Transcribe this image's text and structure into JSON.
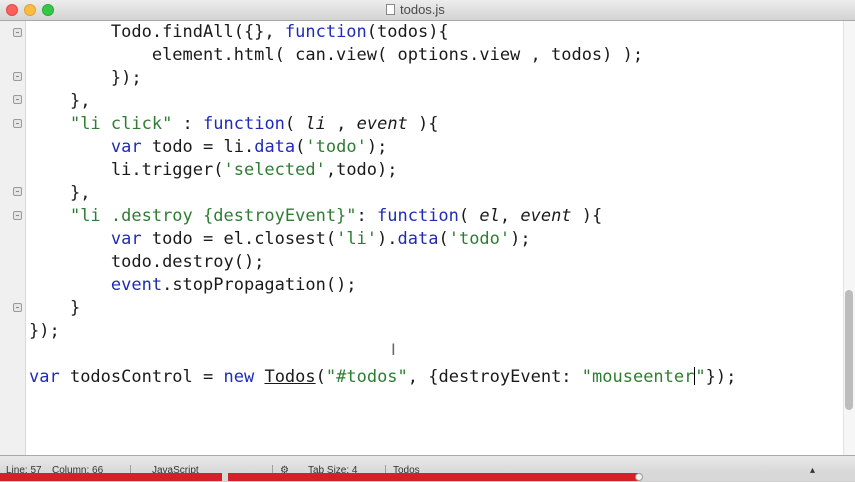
{
  "window": {
    "title": "todos.js"
  },
  "code": {
    "lines": [
      {
        "indent": "        ",
        "tokens": [
          {
            "t": "Todo.findAll({}, ",
            "c": ""
          },
          {
            "t": "function",
            "c": "kw"
          },
          {
            "t": "(todos){",
            "c": ""
          }
        ]
      },
      {
        "indent": "            ",
        "tokens": [
          {
            "t": "element.html( can.view( options.view , todos) );",
            "c": ""
          }
        ]
      },
      {
        "indent": "        ",
        "tokens": [
          {
            "t": "});",
            "c": ""
          }
        ]
      },
      {
        "indent": "    ",
        "tokens": [
          {
            "t": "},",
            "c": ""
          }
        ]
      },
      {
        "indent": "    ",
        "tokens": [
          {
            "t": "\"li click\"",
            "c": "str"
          },
          {
            "t": " : ",
            "c": ""
          },
          {
            "t": "function",
            "c": "kw"
          },
          {
            "t": "( ",
            "c": ""
          },
          {
            "t": "li",
            "c": "it"
          },
          {
            "t": " , ",
            "c": ""
          },
          {
            "t": "event",
            "c": "it"
          },
          {
            "t": " ){",
            "c": ""
          }
        ]
      },
      {
        "indent": "        ",
        "tokens": [
          {
            "t": "var",
            "c": "kw"
          },
          {
            "t": " todo = li.",
            "c": ""
          },
          {
            "t": "data",
            "c": "kw"
          },
          {
            "t": "(",
            "c": ""
          },
          {
            "t": "'todo'",
            "c": "str"
          },
          {
            "t": ");",
            "c": ""
          }
        ]
      },
      {
        "indent": "        ",
        "tokens": [
          {
            "t": "li.trigger(",
            "c": ""
          },
          {
            "t": "'selected'",
            "c": "str"
          },
          {
            "t": ",todo);",
            "c": ""
          }
        ]
      },
      {
        "indent": "    ",
        "tokens": [
          {
            "t": "},",
            "c": ""
          }
        ]
      },
      {
        "indent": "    ",
        "tokens": [
          {
            "t": "\"li .destroy {destroyEvent}\"",
            "c": "str"
          },
          {
            "t": ": ",
            "c": ""
          },
          {
            "t": "function",
            "c": "kw"
          },
          {
            "t": "( ",
            "c": ""
          },
          {
            "t": "el",
            "c": "it"
          },
          {
            "t": ", ",
            "c": ""
          },
          {
            "t": "event",
            "c": "it"
          },
          {
            "t": " ){",
            "c": ""
          }
        ]
      },
      {
        "indent": "        ",
        "tokens": [
          {
            "t": "var",
            "c": "kw"
          },
          {
            "t": " todo = el.closest(",
            "c": ""
          },
          {
            "t": "'li'",
            "c": "str"
          },
          {
            "t": ").",
            "c": ""
          },
          {
            "t": "data",
            "c": "kw"
          },
          {
            "t": "(",
            "c": ""
          },
          {
            "t": "'todo'",
            "c": "str"
          },
          {
            "t": ");",
            "c": ""
          }
        ]
      },
      {
        "indent": "        ",
        "tokens": [
          {
            "t": "todo.destroy();",
            "c": ""
          }
        ]
      },
      {
        "indent": "        ",
        "tokens": [
          {
            "t": "event",
            "c": "kw"
          },
          {
            "t": ".stopPropagation();",
            "c": ""
          }
        ]
      },
      {
        "indent": "    ",
        "tokens": [
          {
            "t": "}",
            "c": ""
          }
        ]
      },
      {
        "indent": "",
        "tokens": [
          {
            "t": "});",
            "c": ""
          }
        ]
      },
      {
        "indent": "",
        "tokens": []
      },
      {
        "indent": "",
        "tokens": [
          {
            "t": "var",
            "c": "kw"
          },
          {
            "t": " todosControl = ",
            "c": ""
          },
          {
            "t": "new",
            "c": "kw"
          },
          {
            "t": " ",
            "c": ""
          },
          {
            "t": "Todos",
            "c": "ul"
          },
          {
            "t": "(",
            "c": ""
          },
          {
            "t": "\"#todos\"",
            "c": "str"
          },
          {
            "t": ", {destroyEvent: ",
            "c": ""
          },
          {
            "t": "\"mouseenter",
            "c": "str"
          },
          {
            "t": "",
            "c": "caret"
          },
          {
            "t": "\"",
            "c": "str"
          },
          {
            "t": "});",
            "c": ""
          }
        ]
      }
    ]
  },
  "status": {
    "line": "Line: 57",
    "column": "Column: 66",
    "syntax": "JavaScript",
    "tab_size": "Tab Size: 4",
    "symbol": "Todos"
  },
  "colors": {
    "keyword": "#1f2bb8",
    "string": "#2e7d32",
    "progress": "#d4202a"
  }
}
